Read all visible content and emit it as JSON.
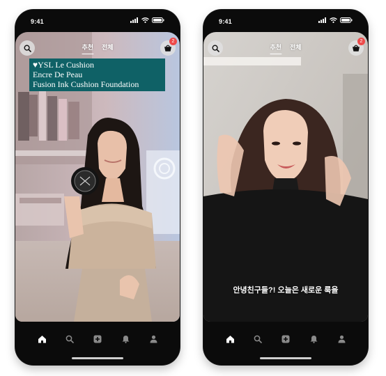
{
  "phones": [
    {
      "status_time": "9:41",
      "tabs": [
        {
          "label": "추천",
          "active": true
        },
        {
          "label": "전체",
          "active": false
        }
      ],
      "cart_badge": "2",
      "caption": {
        "line1": "♥YSL Le Cushion",
        "line2": "Encre De Peau",
        "line3": "Fusion Ink Cushion Foundation"
      }
    },
    {
      "status_time": "9:41",
      "tabs": [
        {
          "label": "추천",
          "active": true
        },
        {
          "label": "전체",
          "active": false
        }
      ],
      "cart_badge": "2",
      "subtitle": "안녕친구들?! 오늘은 새로운 룩을"
    }
  ],
  "icons": {
    "search": "search-icon",
    "cart": "cart-icon",
    "nav": [
      "home-icon",
      "search-icon",
      "plus-square-icon",
      "bell-icon",
      "profile-icon"
    ]
  },
  "colors": {
    "caption_bg": "#0f6166",
    "badge": "#ee4a4a",
    "phone_body": "#0b0b0b"
  }
}
